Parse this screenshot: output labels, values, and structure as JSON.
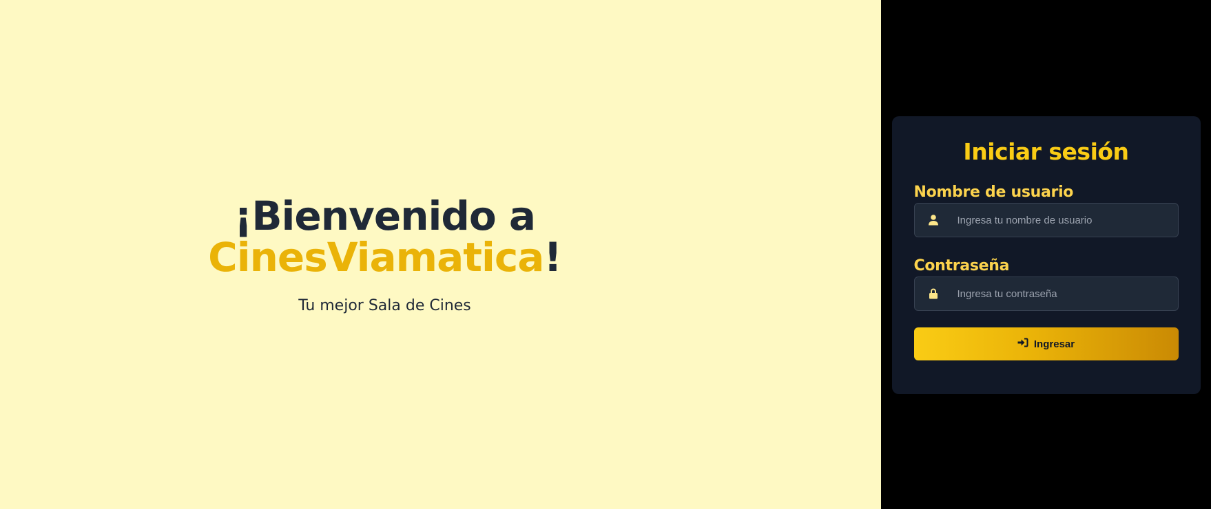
{
  "hero": {
    "title_line1": "¡Bienvenido a",
    "brand": "CinesViamatica",
    "exclamation": "!",
    "subtitle": "Tu mejor Sala de Cines"
  },
  "login": {
    "title": "Iniciar sesión",
    "username": {
      "label": "Nombre de usuario",
      "placeholder": "Ingresa tu nombre de usuario",
      "value": "",
      "icon": "user-icon"
    },
    "password": {
      "label": "Contraseña",
      "placeholder": "Ingresa tu contraseña",
      "value": "",
      "icon": "lock-icon"
    },
    "submit": {
      "label": "Ingresar",
      "icon": "sign-in-icon"
    }
  },
  "colors": {
    "hero_background": "#fef9c3",
    "brand_yellow": "#eab308",
    "dark_text": "#1f2937",
    "card_background": "#111827",
    "title_yellow": "#facc15",
    "label_yellow": "#fcd34d"
  }
}
